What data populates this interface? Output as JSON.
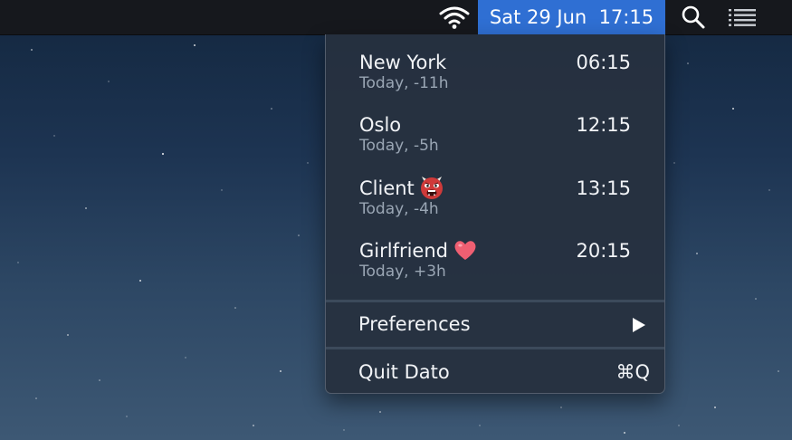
{
  "menubar": {
    "clock_text": "Sat 29 Jun  17:15",
    "wifi_icon": "wifi-icon",
    "search_icon": "search-icon",
    "list_icon": "notification-center-icon",
    "accent": "#2f6fd3"
  },
  "zones": [
    {
      "name": "New York",
      "time": "06:15",
      "sub": "Today, -11h",
      "emoji": ""
    },
    {
      "name": "Oslo",
      "time": "12:15",
      "sub": "Today, -5h",
      "emoji": ""
    },
    {
      "name": "Client",
      "time": "13:15",
      "sub": "Today, -4h",
      "emoji": "ogre-emoji"
    },
    {
      "name": "Girlfriend",
      "time": "20:15",
      "sub": "Today, +3h",
      "emoji": "heart-emoji"
    }
  ],
  "menu": {
    "preferences_label": "Preferences",
    "quit_label": "Quit Dato",
    "quit_shortcut": "⌘Q"
  }
}
